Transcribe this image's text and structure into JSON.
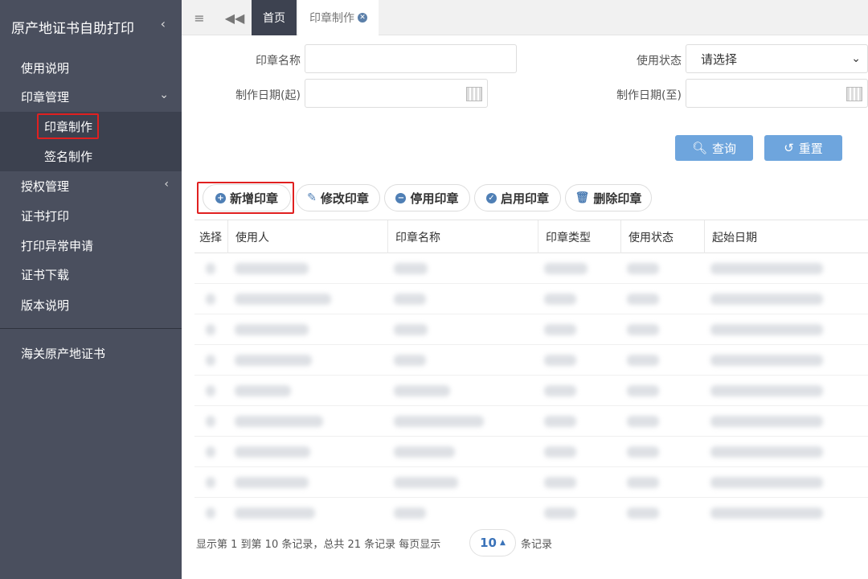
{
  "sidebar": {
    "title": "原产地证书自助打印",
    "items": [
      {
        "label": "使用说明"
      },
      {
        "label": "印章管理"
      },
      {
        "label": "印章制作"
      },
      {
        "label": "签名制作"
      },
      {
        "label": "授权管理"
      },
      {
        "label": "证书打印"
      },
      {
        "label": "打印异常申请"
      },
      {
        "label": "证书下载"
      },
      {
        "label": "版本说明"
      },
      {
        "label": "海关原产地证书"
      }
    ]
  },
  "tabs": {
    "home": "首页",
    "active": "印章制作"
  },
  "search": {
    "seal_name_label": "印章名称",
    "status_label": "使用状态",
    "status_value": "请选择",
    "date_from_label": "制作日期(起)",
    "date_to_label": "制作日期(至)",
    "query_button": "查询",
    "reset_button": "重置"
  },
  "toolbar": {
    "add": "新增印章",
    "edit": "修改印章",
    "disable": "停用印章",
    "enable": "启用印章",
    "delete": "删除印章"
  },
  "table": {
    "columns": [
      "选择",
      "使用人",
      "印章名称",
      "印章类型",
      "使用状态",
      "起始日期"
    ]
  },
  "pager": {
    "summary": "显示第 1 到第 10 条记录，总共 21 条记录 每页显示",
    "page_size": "10",
    "suffix": "条记录"
  },
  "colors": {
    "sidebar_bg": "#4a4f5e",
    "highlight": "#e02020",
    "button_blue": "#6ea5dd"
  }
}
